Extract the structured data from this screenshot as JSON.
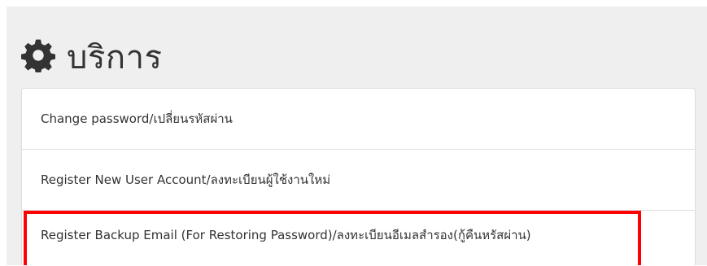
{
  "panel": {
    "title": "บริการ",
    "icon": "gear-icon"
  },
  "services": [
    {
      "label": "Change password/เปลี่ยนรหัสผ่าน"
    },
    {
      "label": "Register New User Account/ลงทะเบียนผู้ใช้งานใหม่"
    },
    {
      "label": "Register Backup Email (For Restoring Password)/ลงทะเบียนอีเมลสำรอง(กู้คืนหรัสผ่าน)"
    }
  ],
  "colors": {
    "panel_background": "#efefef",
    "text": "#333333",
    "highlight": "#ff0000",
    "divider": "#dddddd"
  }
}
